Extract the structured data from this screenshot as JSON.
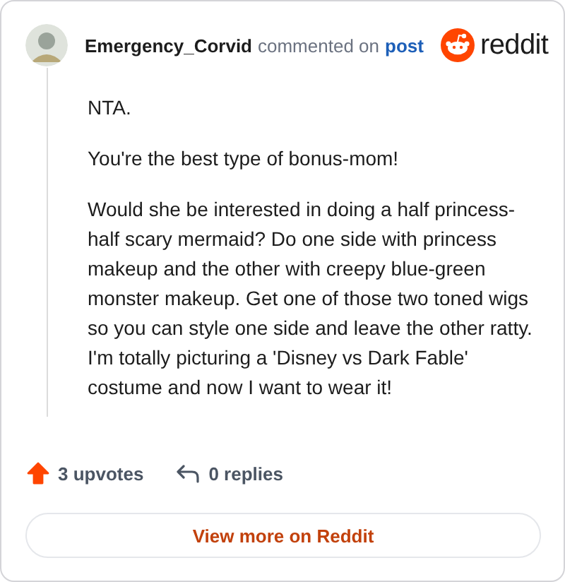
{
  "header": {
    "author": "Emergency_Corvid",
    "action": "commented on",
    "link": "post",
    "brand": "reddit"
  },
  "comment": {
    "paragraphs": [
      "NTA.",
      "You're the best type of bonus-mom!",
      "Would she be interested in doing a half princess-half scary mermaid? Do one side with princess makeup and the other with creepy blue-green monster makeup. Get one of those two toned wigs so you can style one side and leave the other ratty. I'm totally picturing a 'Disney vs Dark Fable' costume and now I want to wear it!"
    ]
  },
  "footer": {
    "upvotes": "3 upvotes",
    "upvoted": true,
    "replies": "0 replies"
  },
  "button": "View more on Reddit"
}
